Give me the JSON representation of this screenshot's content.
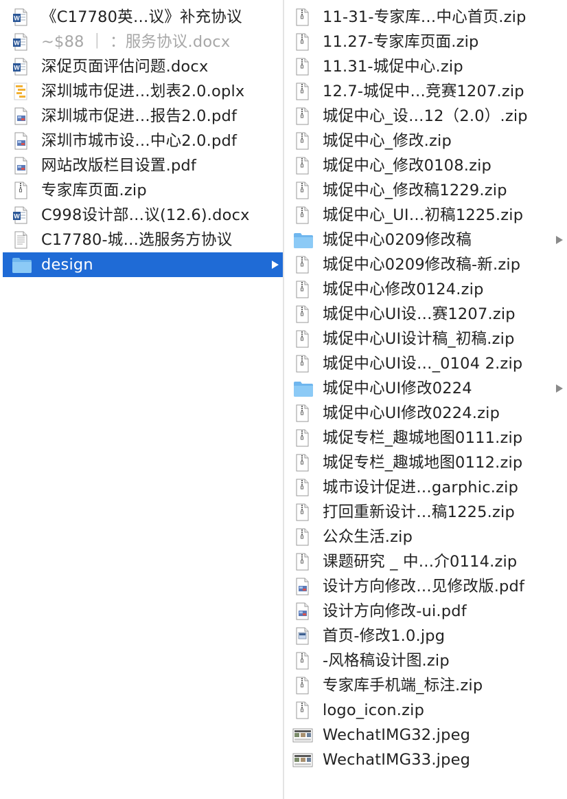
{
  "left_column": {
    "items": [
      {
        "label": "《C17780英…议》补充协议",
        "icon": "word-doc-icon",
        "type": "docx",
        "dim": false,
        "selected": false,
        "has_children": false
      },
      {
        "label": "~$88 ｜ ：服务协议.docx",
        "icon": "word-doc-icon",
        "type": "docx",
        "dim": true,
        "selected": false,
        "has_children": false
      },
      {
        "label": "深促页面评估问题.docx",
        "icon": "word-doc-icon",
        "type": "docx",
        "dim": false,
        "selected": false,
        "has_children": false
      },
      {
        "label": "深圳城市促进…划表2.0.oplx",
        "icon": "omniplan-icon",
        "type": "oplx",
        "dim": false,
        "selected": false,
        "has_children": false
      },
      {
        "label": "深圳城市促进…报告2.0.pdf",
        "icon": "pdf-file-icon",
        "type": "pdf",
        "dim": false,
        "selected": false,
        "has_children": false
      },
      {
        "label": "深圳市城市设…中心2.0.pdf",
        "icon": "pdf-file-icon",
        "type": "pdf",
        "dim": false,
        "selected": false,
        "has_children": false
      },
      {
        "label": "网站改版栏目设置.pdf",
        "icon": "pdf-file-icon",
        "type": "pdf",
        "dim": false,
        "selected": false,
        "has_children": false
      },
      {
        "label": "专家库页面.zip",
        "icon": "zip-file-icon",
        "type": "zip",
        "dim": false,
        "selected": false,
        "has_children": false
      },
      {
        "label": "C998设计部…议(12.6).docx",
        "icon": "word-doc-icon",
        "type": "docx",
        "dim": false,
        "selected": false,
        "has_children": false
      },
      {
        "label": "C17780-城…选服务方协议",
        "icon": "text-file-icon",
        "type": "text",
        "dim": false,
        "selected": false,
        "has_children": false
      },
      {
        "label": "design",
        "icon": "folder-icon",
        "type": "folder",
        "dim": false,
        "selected": true,
        "has_children": true
      }
    ]
  },
  "right_column": {
    "items": [
      {
        "label": "11-31-专家库…中心首页.zip",
        "icon": "zip-file-icon",
        "type": "zip",
        "has_children": false
      },
      {
        "label": "11.27-专家库页面.zip",
        "icon": "zip-file-icon",
        "type": "zip",
        "has_children": false
      },
      {
        "label": "11.31-城促中心.zip",
        "icon": "zip-file-icon",
        "type": "zip",
        "has_children": false
      },
      {
        "label": "12.7-城促中…竞赛1207.zip",
        "icon": "zip-file-icon",
        "type": "zip",
        "has_children": false
      },
      {
        "label": "城促中心_设…12（2.0）.zip",
        "icon": "zip-file-icon",
        "type": "zip",
        "has_children": false
      },
      {
        "label": "城促中心_修改.zip",
        "icon": "zip-file-icon",
        "type": "zip",
        "has_children": false
      },
      {
        "label": "城促中心_修改0108.zip",
        "icon": "zip-file-icon",
        "type": "zip",
        "has_children": false
      },
      {
        "label": "城促中心_修改稿1229.zip",
        "icon": "zip-file-icon",
        "type": "zip",
        "has_children": false
      },
      {
        "label": "城促中心_UI…初稿1225.zip",
        "icon": "zip-file-icon",
        "type": "zip",
        "has_children": false
      },
      {
        "label": "城促中心0209修改稿",
        "icon": "folder-icon",
        "type": "folder",
        "has_children": true
      },
      {
        "label": "城促中心0209修改稿-新.zip",
        "icon": "zip-file-icon",
        "type": "zip",
        "has_children": false
      },
      {
        "label": "城促中心修改0124.zip",
        "icon": "zip-file-icon",
        "type": "zip",
        "has_children": false
      },
      {
        "label": "城促中心UI设…赛1207.zip",
        "icon": "zip-file-icon",
        "type": "zip",
        "has_children": false
      },
      {
        "label": "城促中心UI设计稿_初稿.zip",
        "icon": "zip-file-icon",
        "type": "zip",
        "has_children": false
      },
      {
        "label": "城促中心UI设…_0104 2.zip",
        "icon": "zip-file-icon",
        "type": "zip",
        "has_children": false
      },
      {
        "label": "城促中心UI修改0224",
        "icon": "folder-icon",
        "type": "folder",
        "has_children": true
      },
      {
        "label": "城促中心UI修改0224.zip",
        "icon": "zip-file-icon",
        "type": "zip",
        "has_children": false
      },
      {
        "label": "城促专栏_趣城地图0111.zip",
        "icon": "zip-file-icon",
        "type": "zip",
        "has_children": false
      },
      {
        "label": "城促专栏_趣城地图0112.zip",
        "icon": "zip-file-icon",
        "type": "zip",
        "has_children": false
      },
      {
        "label": "城市设计促进…garphic.zip",
        "icon": "zip-file-icon",
        "type": "zip",
        "has_children": false
      },
      {
        "label": "打回重新设计…稿1225.zip",
        "icon": "zip-file-icon",
        "type": "zip",
        "has_children": false
      },
      {
        "label": "公众生活.zip",
        "icon": "zip-file-icon",
        "type": "zip",
        "has_children": false
      },
      {
        "label": "课题研究 _ 中…介0114.zip",
        "icon": "zip-file-icon",
        "type": "zip",
        "has_children": false
      },
      {
        "label": "设计方向修改…见修改版.pdf",
        "icon": "pdf-file-icon",
        "type": "pdf",
        "has_children": false
      },
      {
        "label": "设计方向修改-ui.pdf",
        "icon": "pdf-file-icon",
        "type": "pdf",
        "has_children": false
      },
      {
        "label": "首页-修改1.0.jpg",
        "icon": "image-file-icon",
        "type": "jpg",
        "has_children": false
      },
      {
        "label": "       -风格稿设计图.zip",
        "icon": "zip-file-icon",
        "type": "zip",
        "has_children": false
      },
      {
        "label": "专家库手机端_标注.zip",
        "icon": "zip-file-icon",
        "type": "zip",
        "has_children": false
      },
      {
        "label": "logo_icon.zip",
        "icon": "zip-file-icon",
        "type": "zip",
        "has_children": false
      },
      {
        "label": "WechatIMG32.jpeg",
        "icon": "image-thumbnail-icon",
        "type": "jpeg",
        "has_children": false
      },
      {
        "label": "WechatIMG33.jpeg",
        "icon": "image-thumbnail-icon",
        "type": "jpeg",
        "has_children": false
      }
    ]
  },
  "colors": {
    "selection": "#1f6bd6",
    "folder": "#6fb6ee",
    "word": "#2b5797",
    "omniplan": "#f2b134",
    "text": "#222222",
    "dim_text": "#a7a7a7"
  }
}
